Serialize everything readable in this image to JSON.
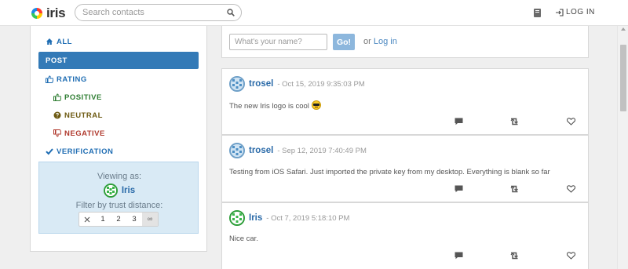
{
  "app": {
    "name": "iris"
  },
  "header": {
    "search_placeholder": "Search contacts",
    "login_label": "LOG IN"
  },
  "sidebar": {
    "items": [
      {
        "label": "ALL",
        "icon": "home-icon"
      },
      {
        "label": "POST",
        "icon": "",
        "active": true
      },
      {
        "label": "RATING",
        "icon": "thumbs-up-icon"
      },
      {
        "label": "POSITIVE",
        "icon": "thumbs-up-icon"
      },
      {
        "label": "NEUTRAL",
        "icon": "question-circle-icon"
      },
      {
        "label": "NEGATIVE",
        "icon": "thumbs-down-icon"
      },
      {
        "label": "VERIFICATION",
        "icon": "checkmark-icon"
      }
    ],
    "viewing": {
      "label": "Viewing as:",
      "name": "Iris",
      "filter_label": "Filter by trust distance:",
      "distances": [
        "1",
        "2",
        "3",
        "∞"
      ],
      "selected_distance": "∞"
    }
  },
  "login_form": {
    "name_placeholder": "What's your name?",
    "go_label": "Go!",
    "or_text": "or",
    "login_link": "Log in"
  },
  "posts": [
    {
      "author": "trosel",
      "date": "- Oct 15, 2019 9:35:03 PM",
      "text": "The new Iris logo is cool",
      "has_emoji": true
    },
    {
      "author": "trosel",
      "date": "- Sep 12, 2019 7:40:49 PM",
      "text": "Testing from iOS Safari. Just imported the private key from my desktop. Everything is blank so far"
    },
    {
      "author": "Iris",
      "date": "- Oct 7, 2019 5:18:10 PM",
      "text": "Nice car."
    }
  ],
  "colors": {
    "accent": "#337ab7",
    "link": "#2a6aa8",
    "viewing_bg": "#d9eaf5"
  }
}
